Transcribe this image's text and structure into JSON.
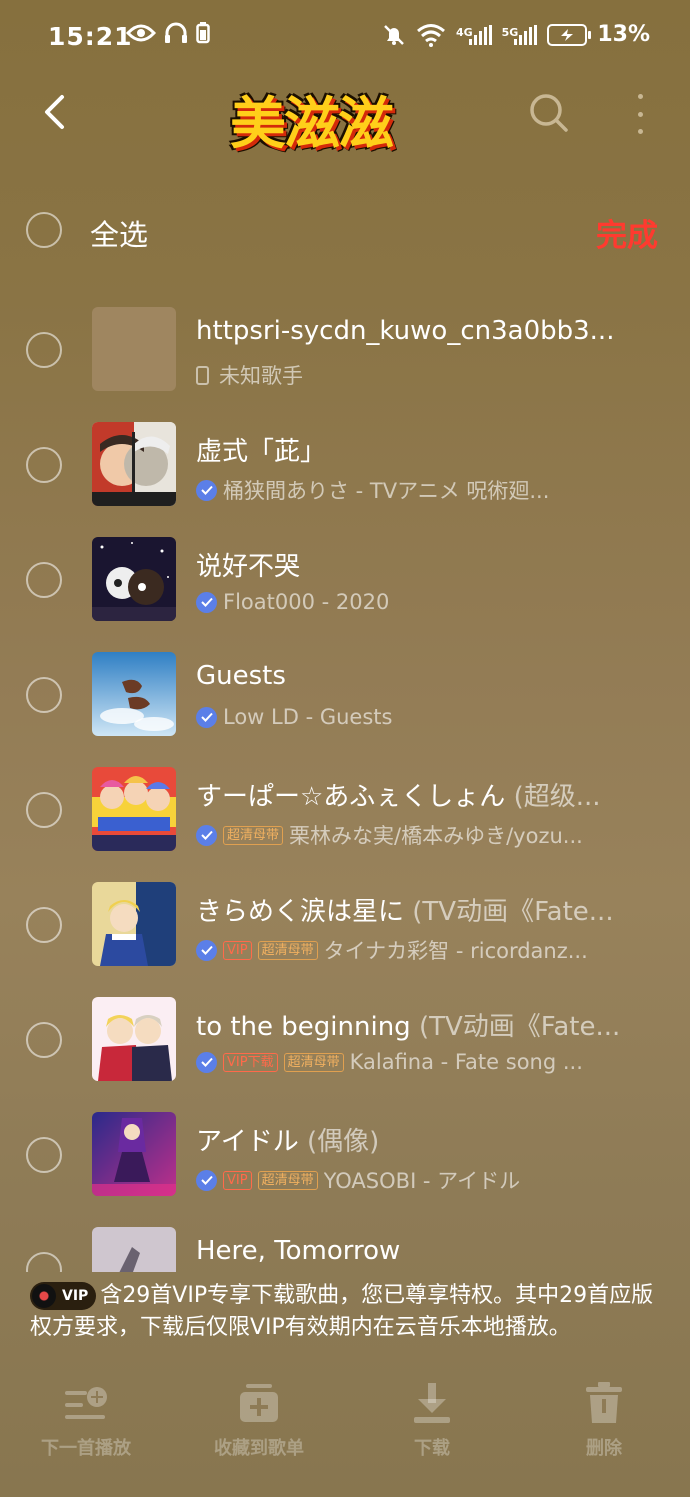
{
  "status_bar": {
    "time": "15:21",
    "net1": "4G",
    "net2": "5G",
    "battery": "13%"
  },
  "header": {
    "logo_text": "美滋滋"
  },
  "select_all": {
    "label": "全选",
    "done": "完成"
  },
  "songs": [
    {
      "title": "httpsri-sycdn_kuwo_cn3a0bb3...",
      "subtitle": "",
      "meta": "未知歌手",
      "tags": [],
      "local": true
    },
    {
      "title": "虚式「茈」",
      "subtitle": "",
      "meta": "桶狭間ありさ - TVアニメ 呪術廻...",
      "tags": []
    },
    {
      "title": "说好不哭",
      "subtitle": "",
      "meta": "Float000 - 2020",
      "tags": []
    },
    {
      "title": "Guests",
      "subtitle": "",
      "meta": "Low LD - Guests",
      "tags": []
    },
    {
      "title": "すーぱー☆あふぇくしょん",
      "subtitle": "(超级...",
      "meta": "栗林みな実/橋本みゆき/yozu...",
      "tags": [
        "超清母带"
      ]
    },
    {
      "title": "きらめく涙は星に",
      "subtitle": "(TV动画《Fate...",
      "meta": "タイナカ彩智 - ricordanz...",
      "tags": [
        "VIP",
        "超清母带"
      ]
    },
    {
      "title": "to the beginning",
      "subtitle": "(TV动画《Fate...",
      "meta": "Kalafina - Fate song ...",
      "tags": [
        "VIP下载",
        "超清母带"
      ]
    },
    {
      "title": "アイドル",
      "subtitle": "(偶像)",
      "meta": "YOASOBI - アイドル",
      "tags": [
        "VIP",
        "超清母带"
      ]
    },
    {
      "title": "Here, Tomorrow",
      "subtitle": "",
      "meta": "",
      "tags": []
    }
  ],
  "notice": {
    "badge": "VIP",
    "text": "含29首VIP专享下载歌曲，您已尊享特权。其中29首应版权方要求，下载后仅限VIP有效期内在云音乐本地播放。"
  },
  "toolbar": [
    {
      "label": "下一首播放",
      "icon": "play-next-icon"
    },
    {
      "label": "收藏到歌单",
      "icon": "add-to-playlist-icon"
    },
    {
      "label": "下载",
      "icon": "download-icon"
    },
    {
      "label": "删除",
      "icon": "delete-icon"
    }
  ],
  "colors": {
    "accent_done": "#ff3a2f",
    "check_blue": "#5b7fe8",
    "tag_hq": "#f0b060",
    "tag_vip": "#ff6a4a"
  }
}
